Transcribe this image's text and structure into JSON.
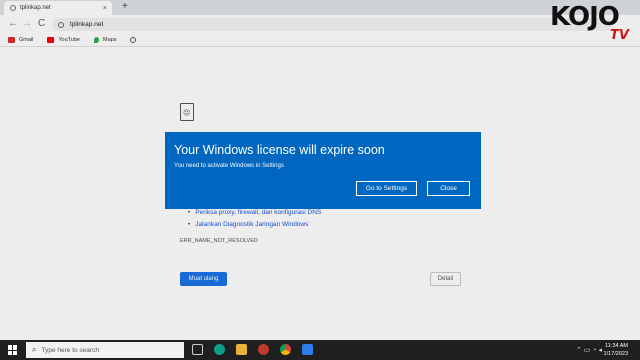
{
  "browser": {
    "tab_title": "tplinkap.net",
    "tab_close": "×",
    "new_tab": "+",
    "url": "tplinkap.net",
    "nav_back": "←",
    "nav_forward": "→",
    "nav_reload": "C",
    "bookmarks": [
      {
        "label": "Gmail",
        "icon": "gmail-icon",
        "color": "#d93025"
      },
      {
        "label": "YouTube",
        "icon": "youtube-icon",
        "color": "#ff0000"
      },
      {
        "label": "Maps",
        "icon": "maps-icon",
        "color": "#34a853"
      },
      {
        "label": "",
        "icon": "globe-icon",
        "color": "#555555"
      }
    ]
  },
  "error_page": {
    "bullets": [
      "Periksa proxy, firewall, dan konfigurasi DNS",
      "Jalankan Diagnostik Jaringan Windows"
    ],
    "error_code": "ERR_NAME_NOT_RESOLVED",
    "reload_label": "Muat ulang",
    "details_label": "Detail"
  },
  "dialog": {
    "title": "Your Windows license will expire soon",
    "subtitle": "You need to activate Windows in Settings",
    "settings_label": "Go to Settings",
    "close_label": "Close",
    "background": "#0067c0"
  },
  "watermark": {
    "text": "KOJO",
    "tv": "TV"
  },
  "taskbar": {
    "search_placeholder": "Type here to search",
    "time": "11:34 AM",
    "date": "1/17/2023",
    "apps": [
      "task-view-icon",
      "edge-icon",
      "file-explorer-icon",
      "app-icon",
      "chrome-icon",
      "app-icon"
    ]
  }
}
